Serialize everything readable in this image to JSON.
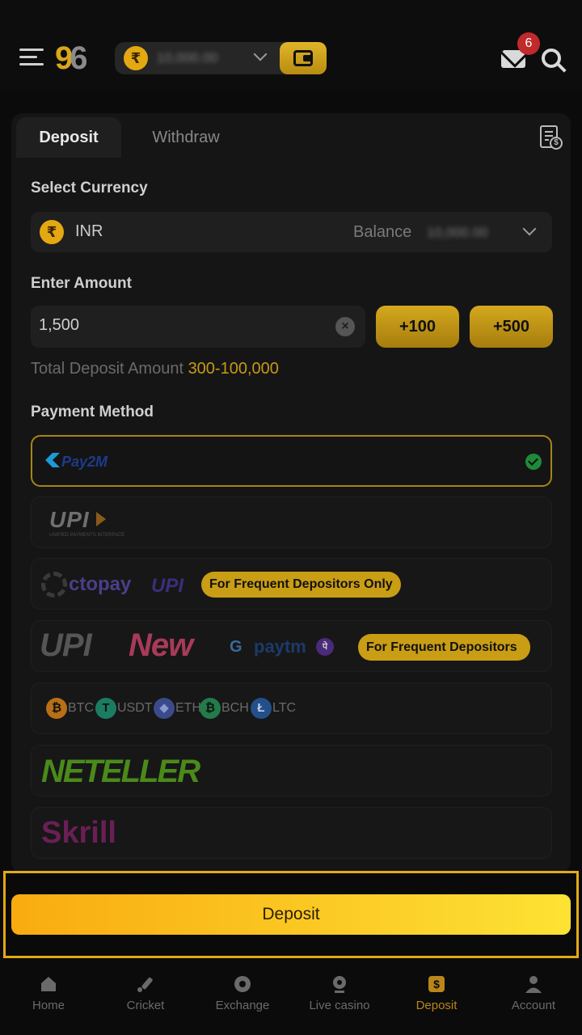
{
  "header": {
    "logo_nine": "9",
    "logo_six": "6",
    "currency_symbol": "₹",
    "balance_masked": "10,000.00",
    "mail_badge_count": "6",
    "icons": [
      "menu-icon",
      "wallet-icon",
      "mail-icon",
      "search-icon"
    ]
  },
  "tabs": [
    {
      "label": "Deposit",
      "active": true
    },
    {
      "label": "Withdraw",
      "active": false
    }
  ],
  "select_currency": {
    "label": "Select Currency",
    "symbol": "₹",
    "code": "INR",
    "balance_label": "Balance",
    "balance_masked": "10,000.00"
  },
  "amount": {
    "label": "Enter Amount",
    "value": "1,500",
    "quick_add": [
      "+100",
      "+500"
    ],
    "total_label": "Total Deposit Amount",
    "range": "300-100,000"
  },
  "payment": {
    "label": "Payment Method",
    "methods": [
      {
        "name": "Pay2M",
        "selected": true
      },
      {
        "name": "UPI",
        "tagline": "UNIFIED PAYMENTS INTERFACE"
      },
      {
        "name": "ctopay",
        "sub": "UPI",
        "badge": "For Frequent Depositors Only"
      },
      {
        "name": "UPI",
        "name_new": "New",
        "g": "G",
        "paytm": "paytm",
        "phonepe": "पे",
        "badge": "For Frequent Depositors"
      },
      {
        "coins": [
          {
            "sym": "₿",
            "label": "BTC",
            "color": "#e08a1e"
          },
          {
            "sym": "T",
            "label": "USDT",
            "color": "#1f9c7a"
          },
          {
            "sym": "◆",
            "label": "ETH",
            "color": "#5a6bb5"
          },
          {
            "sym": "₿",
            "label": "BCH",
            "color": "#2e9c5a"
          },
          {
            "sym": "Ł",
            "label": "LTC",
            "color": "#3366aa"
          }
        ]
      },
      {
        "name": "NETELLER"
      },
      {
        "name": "Skrill"
      }
    ]
  },
  "deposit_button": "Deposit",
  "nav": [
    {
      "label": "Home",
      "icon": "home-icon",
      "active": false
    },
    {
      "label": "Cricket",
      "icon": "cricket-icon",
      "active": false
    },
    {
      "label": "Exchange",
      "icon": "exchange-icon",
      "active": false
    },
    {
      "label": "Live casino",
      "icon": "live-casino-icon",
      "active": false
    },
    {
      "label": "Deposit",
      "icon": "deposit-icon",
      "active": true
    },
    {
      "label": "Account",
      "icon": "account-icon",
      "active": false
    }
  ],
  "colors": {
    "accent": "#e3a915",
    "success": "#1e8a3a",
    "badge_red": "#c02a2a"
  }
}
